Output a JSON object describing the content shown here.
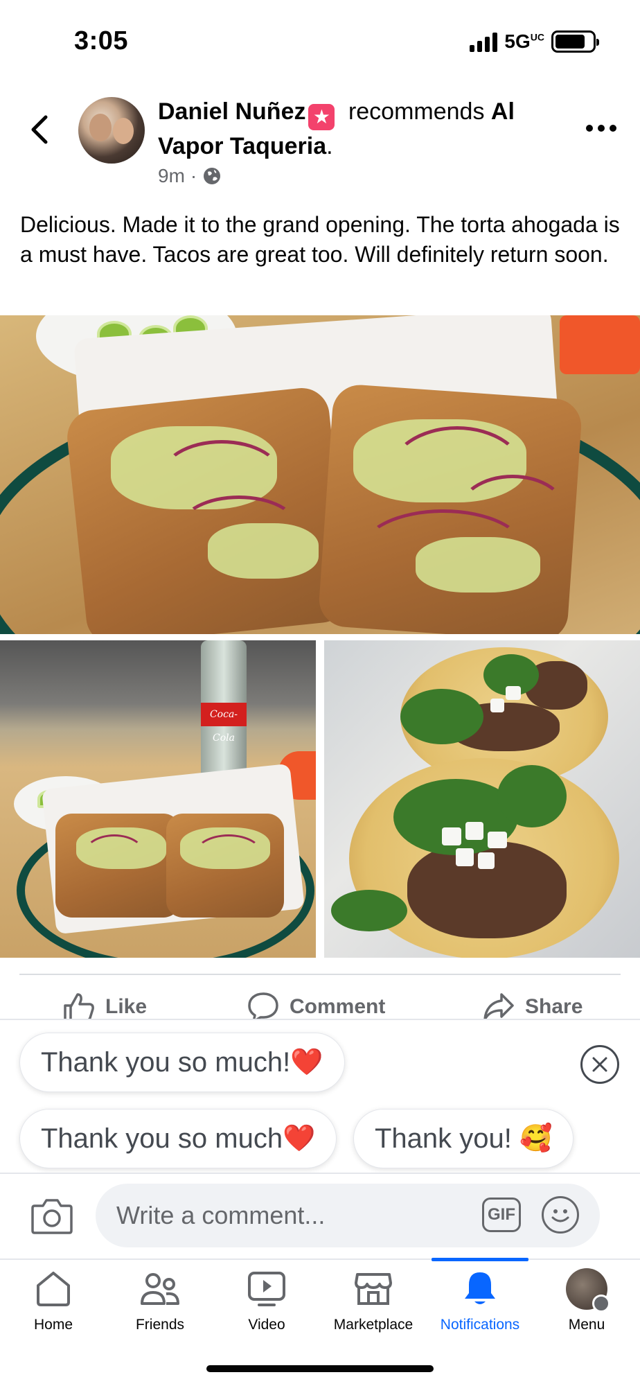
{
  "status_bar": {
    "time": "3:05",
    "network": "5G",
    "network_sup": "UC"
  },
  "post": {
    "author": "Daniel Nuñez",
    "recommends_text": "recommends",
    "place": "Al Vapor Taqueria",
    "period": ".",
    "time_ago": "9m",
    "separator": "·",
    "body": "Delicious. Made it to the grand opening. The torta ahogada is a must have. Tacos are great too. Will definitely return soon.",
    "bottle_label": "Coca-Cola"
  },
  "actions": {
    "like": "Like",
    "comment": "Comment",
    "share": "Share"
  },
  "quick_replies": [
    {
      "text": "Thank you so much!",
      "emoji": "❤️"
    },
    {
      "text": "Thank you so much",
      "emoji": "❤️"
    },
    {
      "text": "Thank you! ",
      "emoji": "🥰"
    }
  ],
  "comment": {
    "placeholder": "Write a comment...",
    "gif_label": "GIF"
  },
  "tabs": [
    {
      "label": "Home",
      "icon": "home-icon"
    },
    {
      "label": "Friends",
      "icon": "friends-icon"
    },
    {
      "label": "Video",
      "icon": "video-icon"
    },
    {
      "label": "Marketplace",
      "icon": "marketplace-icon"
    },
    {
      "label": "Notifications",
      "icon": "bell-icon",
      "active": true
    },
    {
      "label": "Menu",
      "icon": "profile-avatar"
    }
  ],
  "colors": {
    "accent": "#0866ff",
    "secondary_text": "#65676b",
    "badge": "#f3426c"
  }
}
